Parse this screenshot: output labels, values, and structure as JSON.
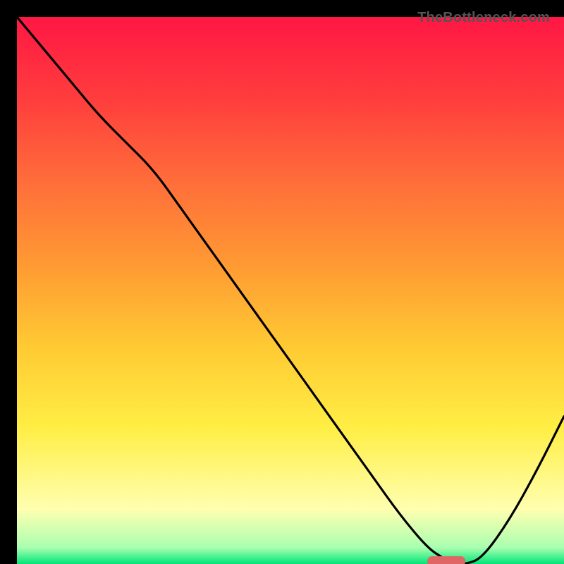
{
  "watermark": "TheBottleneck.com",
  "chart_data": {
    "type": "line",
    "title": "",
    "xlabel": "",
    "ylabel": "",
    "xlim": [
      0,
      100
    ],
    "ylim": [
      0,
      100
    ],
    "x": [
      0,
      5,
      10,
      15,
      20,
      25,
      30,
      35,
      40,
      45,
      50,
      55,
      60,
      65,
      70,
      75,
      78,
      80,
      82,
      85,
      90,
      95,
      100
    ],
    "values": [
      100,
      94,
      88,
      82,
      77,
      72,
      65,
      58,
      51,
      44,
      37,
      30,
      23,
      16,
      9,
      3,
      1,
      0,
      0,
      1,
      8,
      17,
      27
    ],
    "marker": {
      "x_start": 75,
      "x_end": 82,
      "y": 0
    },
    "gradient_stops": [
      {
        "pos": 0,
        "color": "#ff1744"
      },
      {
        "pos": 15,
        "color": "#ff3d3d"
      },
      {
        "pos": 30,
        "color": "#ff6d3a"
      },
      {
        "pos": 45,
        "color": "#ff9933"
      },
      {
        "pos": 60,
        "color": "#ffc933"
      },
      {
        "pos": 75,
        "color": "#ffee44"
      },
      {
        "pos": 90,
        "color": "#ffffb0"
      },
      {
        "pos": 97,
        "color": "#aaffb0"
      },
      {
        "pos": 100,
        "color": "#00e676"
      }
    ]
  }
}
